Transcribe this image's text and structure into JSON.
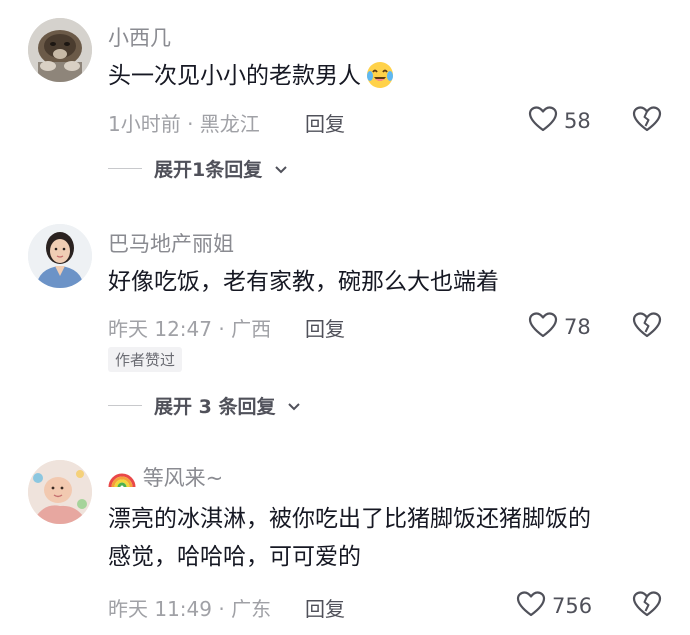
{
  "comments": [
    {
      "username": "小西几",
      "text": "头一次见小小的老款男人",
      "emoji": "laughing-tears-emoji",
      "meta": "1小时前 · 黑龙江",
      "reply_label": "回复",
      "likes": "58",
      "expand_label": "展开1条回复"
    },
    {
      "username": "巴马地产丽姐",
      "text": "好像吃饭，老有家教，碗那么大也端着",
      "meta": "昨天 12:47 · 广西",
      "reply_label": "回复",
      "likes": "78",
      "badge": "作者赞过",
      "expand_label": "展开 3 条回复"
    },
    {
      "username": "等风来~",
      "username_emoji": "rainbow-emoji",
      "text_line1": "漂亮的冰淇淋，被你吃出了比猪脚饭还猪脚饭的",
      "text_line2": "感觉，哈哈哈，可可爱的",
      "meta": "昨天 11:49 · 广东",
      "reply_label": "回复",
      "likes": "756"
    }
  ],
  "icons": {
    "like": "heart-outline-icon",
    "dislike": "broken-heart-icon",
    "expand": "chevron-down-icon"
  },
  "colors": {
    "text": "#161823",
    "secondary": "#8a8b91",
    "meta": "#a0a1a6",
    "action": "#50515a"
  }
}
